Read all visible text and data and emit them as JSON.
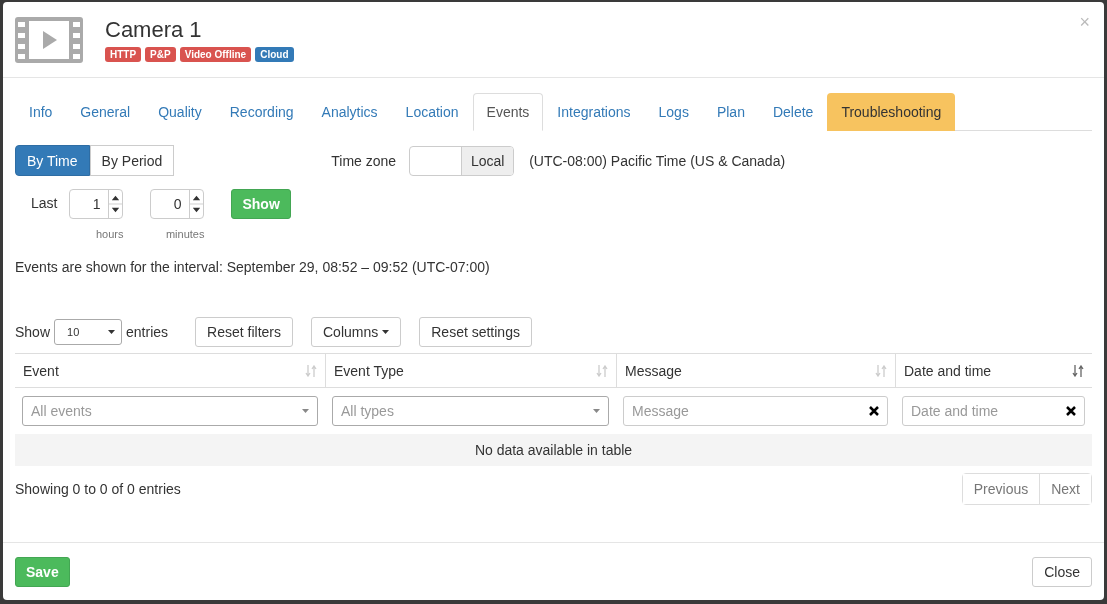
{
  "window": {
    "title": "Camera 1",
    "close": "×"
  },
  "badges": [
    {
      "label": "HTTP",
      "color": "#d9534f"
    },
    {
      "label": "P&P",
      "color": "#d9534f"
    },
    {
      "label": "Video Offline",
      "color": "#d9534f"
    },
    {
      "label": "Cloud",
      "color": "#337ab7"
    }
  ],
  "tabs": [
    {
      "label": "Info",
      "selected": false,
      "kind": "normal"
    },
    {
      "label": "General",
      "selected": false,
      "kind": "normal"
    },
    {
      "label": "Quality",
      "selected": false,
      "kind": "normal"
    },
    {
      "label": "Recording",
      "selected": false,
      "kind": "normal"
    },
    {
      "label": "Analytics",
      "selected": false,
      "kind": "normal"
    },
    {
      "label": "Location",
      "selected": false,
      "kind": "normal"
    },
    {
      "label": "Events",
      "selected": true,
      "kind": "normal"
    },
    {
      "label": "Integrations",
      "selected": false,
      "kind": "normal"
    },
    {
      "label": "Logs",
      "selected": false,
      "kind": "normal"
    },
    {
      "label": "Plan",
      "selected": false,
      "kind": "normal"
    },
    {
      "label": "Delete",
      "selected": false,
      "kind": "normal"
    },
    {
      "label": "Troubleshooting",
      "selected": false,
      "kind": "warning"
    }
  ],
  "mode_toggle": [
    {
      "label": "By Time",
      "selected": true
    },
    {
      "label": "By Period",
      "selected": false
    }
  ],
  "time_zone": {
    "label": "Time zone",
    "button": "Local",
    "value": "(UTC-08:00) Pacific Time (US & Canada)"
  },
  "last": {
    "label": "Last",
    "hours": {
      "value": "1",
      "caption": "hours"
    },
    "minutes": {
      "value": "0",
      "caption": "minutes"
    },
    "button": "Show"
  },
  "interval_text": "Events are shown for the interval: September 29, 08:52 – 09:52 (UTC-07:00)",
  "table_controls": {
    "show_label": "Show",
    "page_size": "10",
    "entries_label": "entries",
    "buttons": [
      "Reset filters",
      "Columns",
      "Reset settings"
    ]
  },
  "table": {
    "columns": [
      {
        "label": "Event",
        "sorted": false,
        "filter": {
          "kind": "select",
          "placeholder": "All events"
        }
      },
      {
        "label": "Event Type",
        "sorted": false,
        "filter": {
          "kind": "select",
          "placeholder": "All types"
        }
      },
      {
        "label": "Message",
        "sorted": false,
        "filter": {
          "kind": "text",
          "placeholder": "Message"
        }
      },
      {
        "label": "Date and time",
        "sorted": true,
        "filter": {
          "kind": "text",
          "placeholder": "Date and time"
        }
      }
    ],
    "empty": "No data available in table",
    "info": "Showing 0 to 0 of 0 entries",
    "pager": [
      "Previous",
      "Next"
    ]
  },
  "footer": {
    "save": "Save",
    "close": "Close"
  }
}
